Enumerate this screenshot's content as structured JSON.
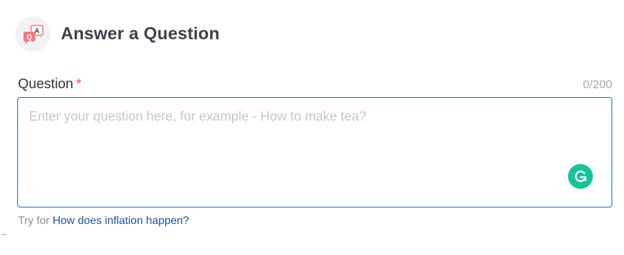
{
  "header": {
    "title": "Answer a Question",
    "icon": "qa-speech-bubbles-icon",
    "icon_letters": {
      "q": "Q",
      "a": "A"
    }
  },
  "question_field": {
    "label": "Question",
    "required_marker": "*",
    "counter": "0/200",
    "value": "",
    "placeholder": "Enter your question here, for example - How to make tea?"
  },
  "suggestion": {
    "prefix": "Try for",
    "link_text": "How does inflation happen?"
  },
  "colors": {
    "accent": "#2858a8",
    "link": "#1d4fa8",
    "required": "#ef4d4d",
    "grammarly": "#15c39a",
    "icon_bubble": "#f47a7a"
  }
}
